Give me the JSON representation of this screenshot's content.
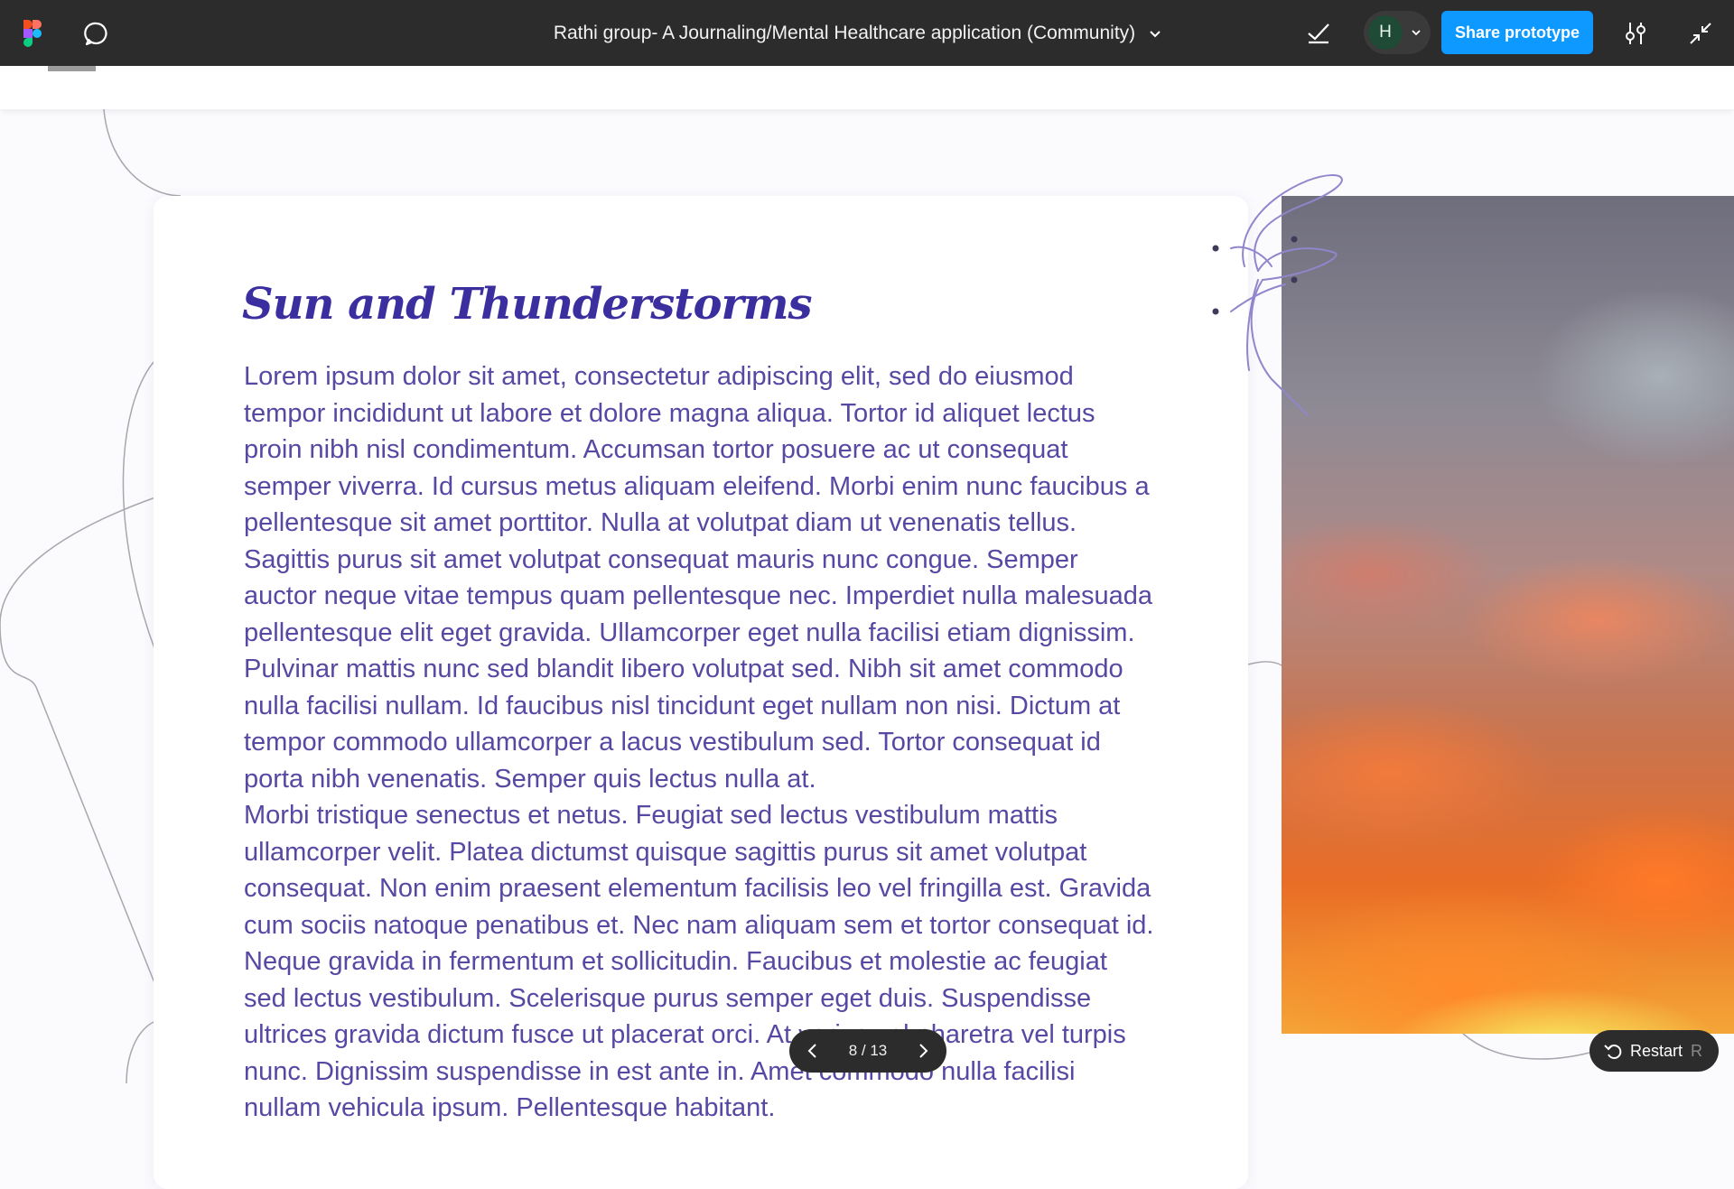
{
  "toolbar": {
    "title": "Rathi group- A Journaling/Mental Healthcare application (Community)",
    "avatar_initial": "H",
    "share_label": "Share prototype"
  },
  "content": {
    "heading": "Sun and Thunderstorms",
    "paragraph_1": "Lorem ipsum dolor sit amet, consectetur adipiscing elit, sed do eiusmod tempor incididunt ut labore et dolore magna aliqua. Tortor id aliquet lectus proin nibh nisl condimentum. Accumsan tortor posuere ac ut consequat semper viverra. Id cursus metus aliquam eleifend. Morbi enim nunc faucibus a pellentesque sit amet porttitor. Nulla at volutpat diam ut venenatis tellus. Sagittis purus sit amet volutpat consequat mauris nunc congue. Semper auctor neque vitae tempus quam pellentesque nec. Imperdiet nulla malesuada pellentesque elit eget gravida. Ullamcorper eget nulla facilisi etiam dignissim. Pulvinar mattis nunc sed blandit libero volutpat sed. Nibh sit amet commodo nulla facilisi nullam. Id faucibus nisl tincidunt eget nullam non nisi. Dictum at tempor commodo ullamcorper a lacus vestibulum sed. Tortor consequat id porta nibh venenatis. Semper quis lectus nulla at.",
    "paragraph_2": "Morbi tristique senectus et netus. Feugiat sed lectus vestibulum mattis ullamcorper velit. Platea dictumst quisque sagittis purus sit amet volutpat consequat. Non enim praesent elementum facilisis leo vel fringilla est. Gravida cum sociis natoque penatibus et. Nec nam aliquam sem et tortor consequat id. Neque gravida in fermentum et sollicitudin. Faucibus et molestie ac feugiat sed lectus vestibulum. Scelerisque purus semper eget duis. Suspendisse ultrices gravida dictum fusce ut placerat orci. At varius vel pharetra vel turpis nunc. Dignissim suspendisse in est ante in. Amet commodo nulla facilisi nullam vehicula ipsum. Pellentesque habitant."
  },
  "pager": {
    "count": "8 / 13"
  },
  "restart": {
    "label": "Restart",
    "shortcut": "R"
  },
  "colors": {
    "topbar": "#2c2c2c",
    "accent": "#0d99ff",
    "heading": "#3b2fa0",
    "body_text": "#5648a3"
  },
  "icons": [
    "figma-logo-icon",
    "comment-icon",
    "chevron-down-icon",
    "checkmark-icon",
    "settings-sliders-icon",
    "collapse-icon",
    "chevron-left-icon",
    "chevron-right-icon",
    "restart-icon"
  ]
}
